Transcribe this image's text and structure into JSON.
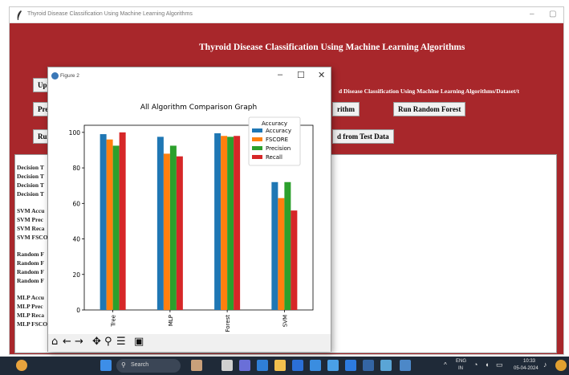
{
  "main_window": {
    "title": "Thyroid Disease Classification Using Machine Learning Algorithms",
    "heading": "Thyroid Disease Classification Using Machine Learning Algorithms",
    "buttons": {
      "upload": "Upl",
      "preprocess": "Pre",
      "run_row3": "Run",
      "algorithm_visible": "rithm",
      "random_forest": "Run Random Forest",
      "predict_visible": "d from Test Data"
    },
    "path_label": "d Disease Classification Using Machine Learning Algorithms/Dataset/t",
    "output_lines": [
      "Decision T",
      "Decision T",
      "Decision T",
      "Decision T",
      "",
      "SVM Accu",
      "SVM Prec",
      "SVM Reca",
      "SVM FSCO",
      "",
      "Random F",
      "Random F",
      "Random F",
      "Random F",
      "",
      "MLP Accu",
      "MLP Prec",
      "MLP Reca",
      "MLP FSCO"
    ]
  },
  "figure_window": {
    "title": "Figure 2",
    "controls": {
      "minimize": "–",
      "maximize": "☐",
      "close": "✕"
    },
    "toolbar": [
      "home-icon",
      "back-icon",
      "forward-icon",
      "pan-icon",
      "zoom-icon",
      "configure-icon",
      "save-icon"
    ]
  },
  "chart_data": {
    "type": "bar",
    "title": "All Algorithm Comparison Graph",
    "categories": [
      "Tree",
      "MLP",
      "Forest",
      "SVM"
    ],
    "legend_title": "Accuracy",
    "legend_position": "top-right",
    "series": [
      {
        "name": "Accuracy",
        "color": "#1f77b4",
        "values": [
          99,
          97.5,
          99.5,
          72
        ]
      },
      {
        "name": "FSCORE",
        "color": "#ff7f0e",
        "values": [
          96,
          88,
          98,
          63
        ]
      },
      {
        "name": "Precision",
        "color": "#2ca02c",
        "values": [
          92.5,
          92.5,
          97.5,
          72
        ]
      },
      {
        "name": "Recall",
        "color": "#d62728",
        "values": [
          100,
          86.5,
          98,
          56
        ]
      }
    ],
    "yticks": [
      0,
      20,
      40,
      60,
      80,
      100
    ],
    "ylim": [
      0,
      104
    ],
    "grid": false
  },
  "taskbar": {
    "search": "Search",
    "lang_top": "ENG",
    "lang_bottom": "IN",
    "time": "10:33",
    "date": "05-04-2024"
  }
}
